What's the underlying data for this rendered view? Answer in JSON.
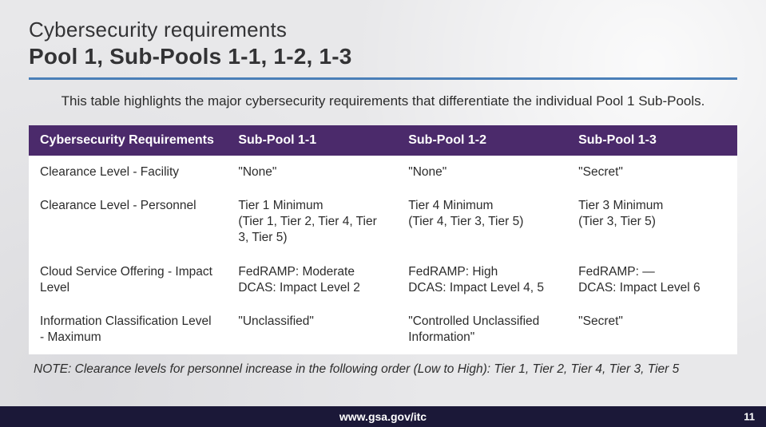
{
  "header": {
    "supertitle": "Cybersecurity requirements",
    "title": "Pool 1, Sub-Pools 1-1, 1-2, 1-3"
  },
  "description": "This table highlights the major cybersecurity requirements that differentiate the individual Pool 1 Sub-Pools.",
  "table": {
    "headers": [
      "Cybersecurity Requirements",
      "Sub-Pool 1-1",
      "Sub-Pool 1-2",
      "Sub-Pool 1-3"
    ],
    "rows": [
      {
        "label": "Clearance Level - Facility",
        "c1": "\"None\"",
        "c2": "\"None\"",
        "c3": "\"Secret\""
      },
      {
        "label": "Clearance Level - Personnel",
        "c1": "Tier 1 Minimum\n(Tier 1, Tier 2, Tier 4, Tier 3, Tier 5)",
        "c2": "Tier 4 Minimum\n(Tier 4, Tier 3, Tier 5)",
        "c3": "Tier 3 Minimum\n(Tier 3, Tier 5)"
      },
      {
        "label": "Cloud Service Offering - Impact Level",
        "c1": "FedRAMP: Moderate\nDCAS: Impact Level 2",
        "c2": "FedRAMP: High\nDCAS: Impact Level 4, 5",
        "c3": "FedRAMP: —\nDCAS: Impact Level 6"
      },
      {
        "label": "Information Classification Level - Maximum",
        "c1": "\"Unclassified\"",
        "c2": "\"Controlled Unclassified Information\"",
        "c3": "\"Secret\""
      }
    ]
  },
  "note": "NOTE: Clearance levels for personnel increase in the following order (Low to High): Tier 1, Tier 2, Tier 4, Tier 3, Tier 5",
  "footer": {
    "url": "www.gsa.gov/itc",
    "page": "11"
  }
}
